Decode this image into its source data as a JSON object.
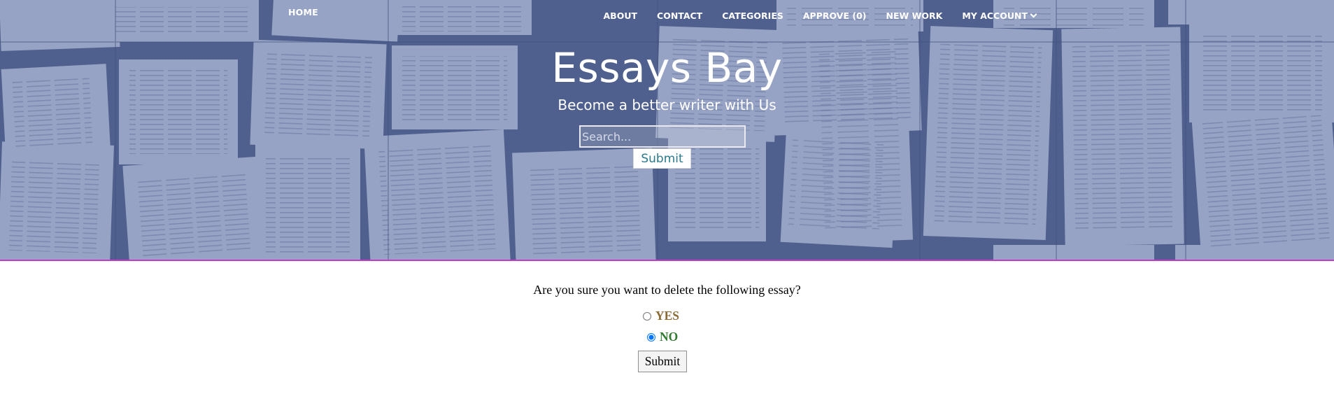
{
  "nav": {
    "home": "HOME",
    "items": [
      {
        "id": "about",
        "label": "ABOUT"
      },
      {
        "id": "contact",
        "label": "CONTACT"
      },
      {
        "id": "categories",
        "label": "CATEGORIES"
      },
      {
        "id": "approve",
        "label": "APPROVE (0)"
      },
      {
        "id": "new-work",
        "label": "NEW WORK"
      }
    ],
    "account": "MY ACCOUNT",
    "account_icon": "chevron-down-icon"
  },
  "hero": {
    "title": "Essays Bay",
    "tagline": "Become a better writer with Us",
    "search_placeholder": "Search...",
    "search_submit": "Submit",
    "background": "open-books-photo"
  },
  "delete_form": {
    "question": "Are you sure you want to delete the following essay?",
    "options": [
      {
        "label": "YES",
        "checked": false
      },
      {
        "label": "NO",
        "checked": true
      }
    ],
    "submit": "Submit"
  },
  "colors": {
    "hero_tint": "#5a6c98",
    "divider": "#c23cc8",
    "yes": "#8a6a35",
    "no": "#2f7a2f",
    "search_submit_text": "#2a7a8c"
  }
}
